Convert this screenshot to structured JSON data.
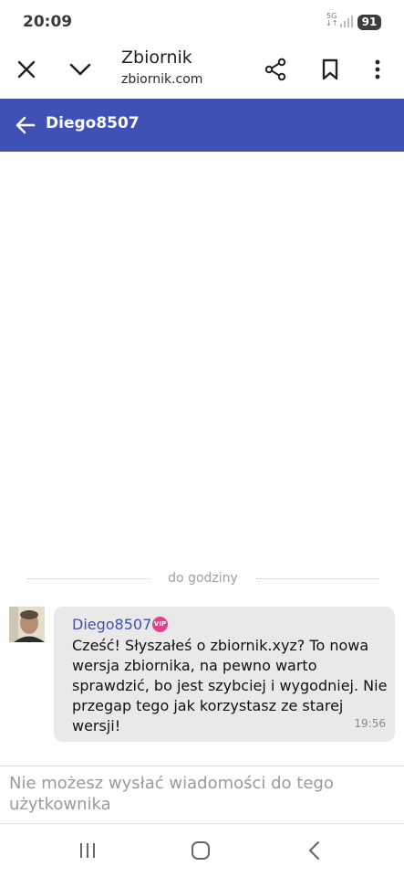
{
  "status_bar": {
    "time": "20:09",
    "network": "5G",
    "battery": "91"
  },
  "browser": {
    "title": "Zbiornik",
    "url": "zbiornik.com",
    "icons": [
      "close-icon",
      "chevron-down-icon",
      "share-icon",
      "bookmark-icon",
      "more-vertical-icon"
    ]
  },
  "header": {
    "title": "Diego8507",
    "color": "#3f51b5"
  },
  "chat": {
    "divider_label": "do godziny",
    "messages": [
      {
        "sender": "Diego8507",
        "badge": "VIP",
        "text": "Cześć! Słyszałeś o zbiornik.xyz? To nowa wersja zbiornika, na pewno warto sprawdzić, bo jest szybciej i wygodniej. Nie przegap tego jak korzystasz ze starej wersji!",
        "time": "19:56"
      }
    ]
  },
  "footer": {
    "notice": "Nie możesz wysłać wiadomości do tego użytkownika"
  },
  "nav": {
    "icons": [
      "recents-icon",
      "home-icon",
      "back-icon"
    ]
  }
}
